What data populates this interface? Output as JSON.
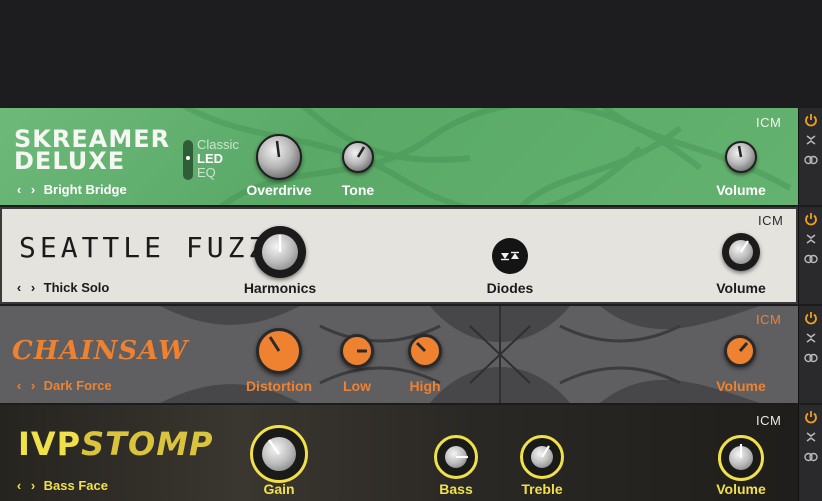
{
  "colors": {
    "skreamer_bg": "#5aa967",
    "seattle_bg": "#e5e3de",
    "chainsaw_bg": "#5f5f62",
    "chainsaw_accent": "#ee8230",
    "ivp_accent": "#f0e04a",
    "power_on": "#f0a020"
  },
  "icons": {
    "power": "power-icon",
    "collapse": "chevron-collapse-icon",
    "link": "link-icon",
    "prev": "chevron-left-icon",
    "next": "chevron-right-icon"
  },
  "skreamer": {
    "title_line1": "SKREAMER",
    "title_line2": "DELUXE",
    "brand": "ICM",
    "modes": [
      "Classic",
      "LED",
      "EQ"
    ],
    "preset": "Bright Bridge",
    "knobs": {
      "overdrive": "Overdrive",
      "tone": "Tone",
      "volume": "Volume"
    }
  },
  "seattle": {
    "title": "SEATTLE FUZZ",
    "brand": "ICM",
    "preset": "Thick Solo",
    "knobs": {
      "harmonics": "Harmonics",
      "diodes": "Diodes",
      "volume": "Volume"
    }
  },
  "chainsaw": {
    "title": "CHAINSAW",
    "brand": "ICM",
    "preset": "Dark Force",
    "knobs": {
      "distortion": "Distortion",
      "low": "Low",
      "high": "High",
      "volume": "Volume"
    }
  },
  "ivp": {
    "title_a": "IVP",
    "title_b": "STOMP",
    "brand": "ICM",
    "preset": "Bass Face",
    "knobs": {
      "gain": "Gain",
      "bass": "Bass",
      "treble": "Treble",
      "volume": "Volume"
    }
  }
}
